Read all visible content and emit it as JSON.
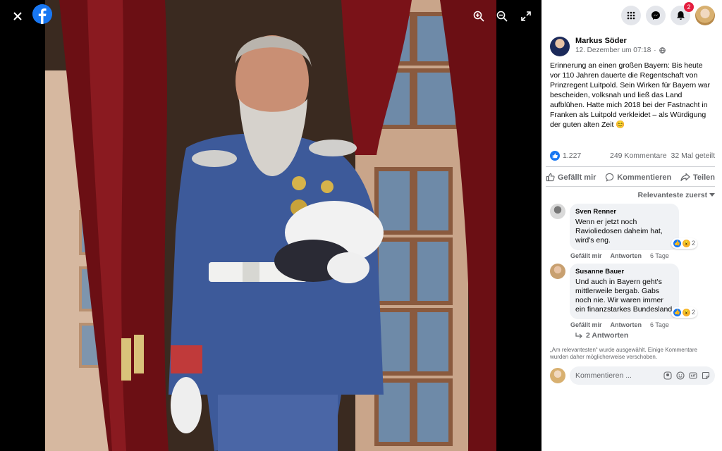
{
  "viewer": {
    "icons": [
      "close-icon",
      "facebook-logo-icon",
      "zoom-in-icon",
      "zoom-out-icon",
      "fullscreen-icon"
    ]
  },
  "topbar": {
    "notifications_count": "2"
  },
  "post": {
    "author": "Markus Söder",
    "date": "12. Dezember um 07:18",
    "separator": "·",
    "text": "Erinnerung an einen großen Bayern: Bis heute vor 110 Jahren dauerte die Regentschaft von Prinzregent Luitpold. Sein Wirken für Bayern war bescheiden, volksnah und ließ das Land aufblühen. Hatte mich 2018 bei der Fastnacht in Franken als Luitpold verkleidet – als Würdigung der guten alten Zeit 😊",
    "likes": "1.227",
    "comments_count": "249 Kommentare",
    "shares": "32 Mal geteilt"
  },
  "actions": {
    "like": "Gefällt mir",
    "comment": "Kommentieren",
    "share": "Teilen"
  },
  "sort_label": "Relevanteste zuerst",
  "comments": [
    {
      "name": "Sven Renner",
      "text": "Wenn er jetzt noch Ravioliedosen daheim hat, wird's eng.",
      "reactions": "2",
      "like": "Gefällt mir",
      "reply": "Antworten",
      "time": "6 Tage"
    },
    {
      "name": "Susanne Bauer",
      "text": "Und auch in Bayern geht's mittlerweile bergab. Gabs noch nie. Wir waren immer ein finanzstarkes Bundesland",
      "reactions": "2",
      "like": "Gefällt mir",
      "reply": "Antworten",
      "time": "6 Tage"
    }
  ],
  "replies_label": "2 Antworten",
  "filter_note": "„Am relevantesten“ wurde ausgewählt. Einige Kommentare wurden daher möglicherweise verschoben.",
  "compose_placeholder": "Kommentieren ...",
  "colors": {
    "brand": "#1877f2",
    "notification": "#e41e3f"
  }
}
